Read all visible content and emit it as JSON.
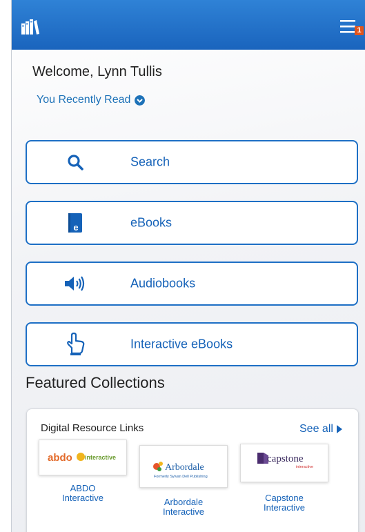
{
  "user": {
    "welcome": "Welcome, Lynn Tullis",
    "recently_read": "You Recently Read"
  },
  "header": {
    "notification_count": "1"
  },
  "nav": [
    {
      "label": "Search",
      "icon": "search-icon"
    },
    {
      "label": "eBooks",
      "icon": "ebook-icon"
    },
    {
      "label": "Audiobooks",
      "icon": "speaker-icon"
    },
    {
      "label": "Interactive eBooks",
      "icon": "touch-hand-icon"
    }
  ],
  "featured": {
    "title": "Featured Collections",
    "card_title": "Digital Resource Links",
    "see_all": "See all",
    "items": [
      {
        "label_line1": "ABDO",
        "label_line2": "Interactive",
        "logo_text": "abdo",
        "logo_text2": "interactive"
      },
      {
        "label_line1": "Arbordale",
        "label_line2": "Interactive",
        "logo_text": "Arbordale",
        "logo_sub": "Formerly Sylvan Dell Publishing"
      },
      {
        "label_line1": "Capstone",
        "label_line2": "Interactive",
        "logo_text": "capstone",
        "logo_sub": "interactive"
      }
    ]
  },
  "colors": {
    "header_blue": "#1f6fc9",
    "accent_blue": "#1562b8",
    "badge_orange": "#e0541c"
  }
}
